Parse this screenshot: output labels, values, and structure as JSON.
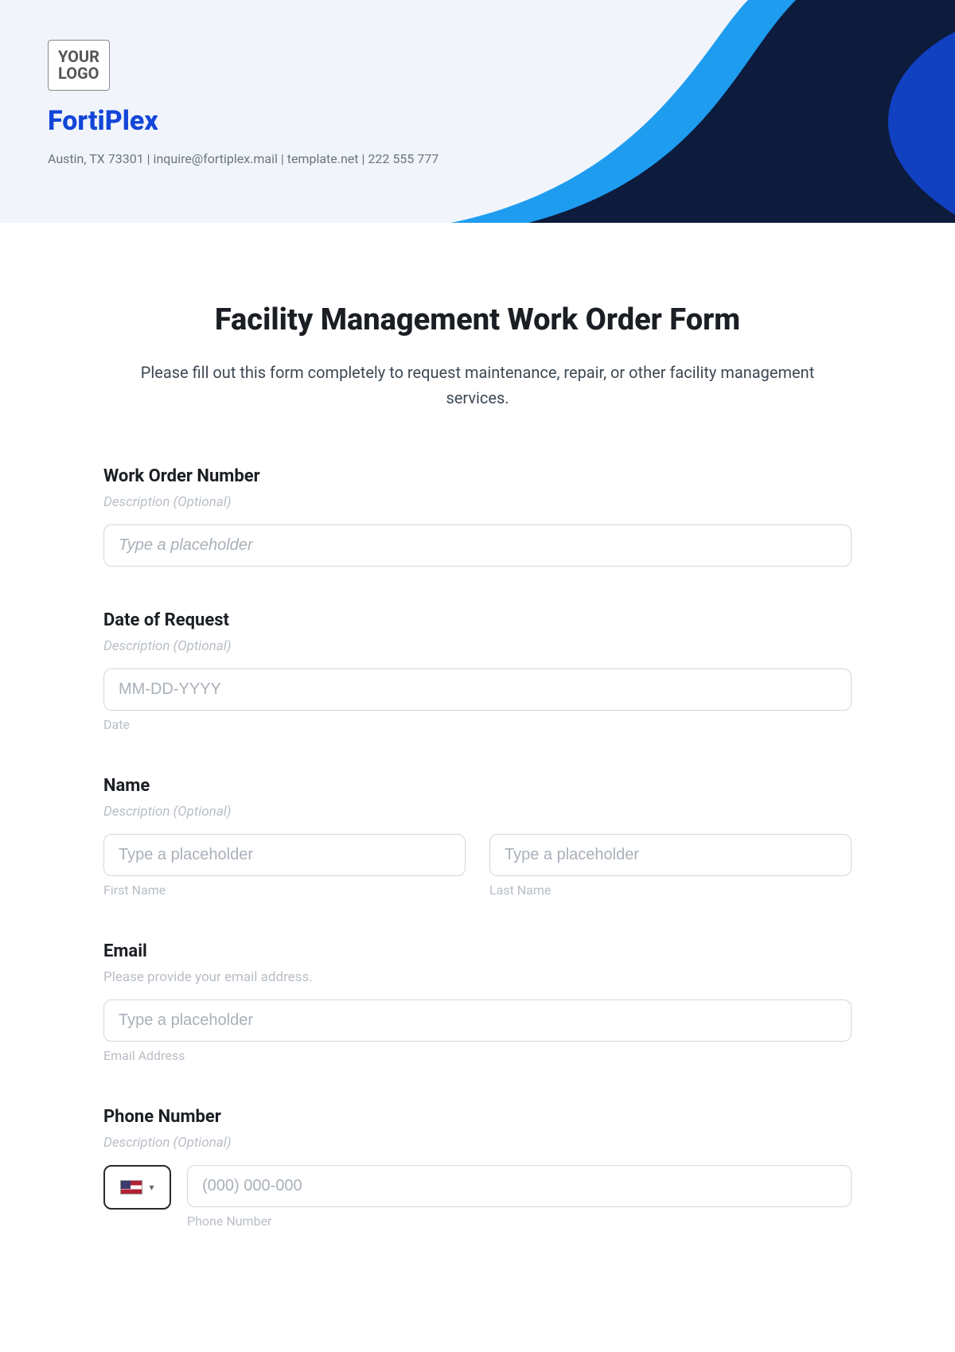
{
  "header": {
    "logo_line1": "YOUR",
    "logo_line2": "LOGO",
    "company_name": "FortiPlex",
    "company_info": "Austin, TX 73301 | inquire@fortiplex.mail | template.net | 222 555 777"
  },
  "form": {
    "title": "Facility Management Work Order Form",
    "subtitle": "Please fill out this form completely to request maintenance, repair, or other facility management services."
  },
  "fields": {
    "work_order": {
      "label": "Work Order Number",
      "desc": "Description (Optional)",
      "placeholder": "Type a placeholder"
    },
    "date_request": {
      "label": "Date of Request",
      "desc": "Description (Optional)",
      "placeholder": "MM-DD-YYYY",
      "sublabel": "Date"
    },
    "name": {
      "label": "Name",
      "desc": "Description (Optional)",
      "first_placeholder": "Type a placeholder",
      "first_sublabel": "First Name",
      "last_placeholder": "Type a placeholder",
      "last_sublabel": "Last Name"
    },
    "email": {
      "label": "Email",
      "desc": "Please provide your email address.",
      "placeholder": "Type a placeholder",
      "sublabel": "Email Address"
    },
    "phone": {
      "label": "Phone Number",
      "desc": "Description (Optional)",
      "placeholder": "(000) 000-000",
      "sublabel": "Phone Number"
    }
  }
}
